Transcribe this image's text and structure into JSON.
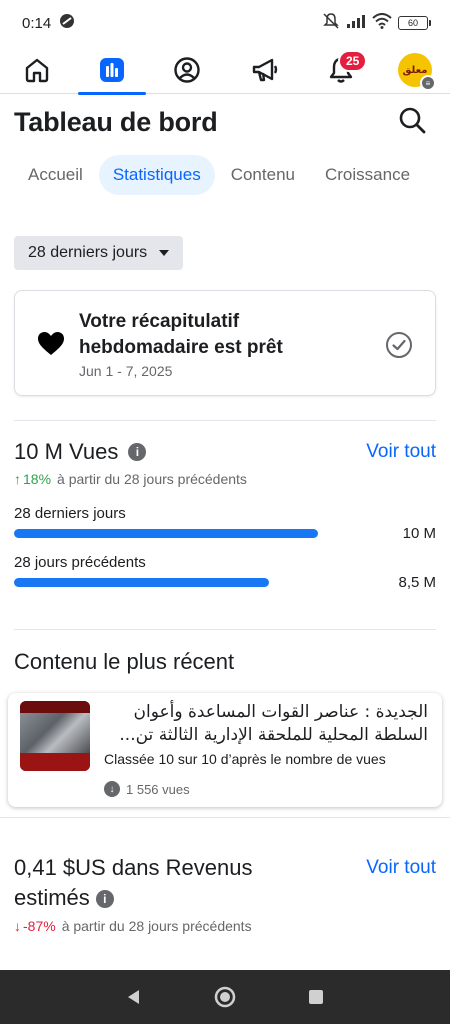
{
  "status_bar": {
    "time": "0:14",
    "battery": "60"
  },
  "nav": {
    "notification_count": "25",
    "avatar_text": "معلق"
  },
  "header": {
    "title": "Tableau de bord"
  },
  "tabs": [
    {
      "label": "Accueil"
    },
    {
      "label": "Statistiques"
    },
    {
      "label": "Contenu"
    },
    {
      "label": "Croissance"
    }
  ],
  "date_range": {
    "label": "28 derniers jours"
  },
  "recap": {
    "title": "Votre récapitulatif hebdomadaire est prêt",
    "dates": "Jun 1 - 7, 2025"
  },
  "views": {
    "title": "10 M Vues",
    "see_all": "Voir tout",
    "delta_pct": "18%",
    "delta_text": "à partir du 28 jours précédents",
    "bars": [
      {
        "label": "28 derniers jours",
        "value": "10 M",
        "ratio": 1.0
      },
      {
        "label": "28 jours précédents",
        "value": "8,5 M",
        "ratio": 0.84
      }
    ],
    "colors": {
      "bar": "#1877f2",
      "up": "#31a24c"
    }
  },
  "recent": {
    "section_title": "Contenu le plus récent",
    "post_text": "الجديدة : عناصر القوات المساعدة وأعوان السلطة المحلية للملحقة الإدارية الثالثة تن...",
    "rank": "Classée 10 sur 10 d’après le nombre de vues",
    "views": "1 556 vues"
  },
  "revenue": {
    "title": "0,41 $US dans Revenus estimés",
    "see_all": "Voir tout",
    "delta_pct": "-87%",
    "delta_text": "à partir du 28 jours précédents",
    "colors": {
      "down": "#e41e3f"
    }
  },
  "theme": {
    "accent": "#0866ff",
    "tab_active_bg": "#e7f3ff"
  }
}
